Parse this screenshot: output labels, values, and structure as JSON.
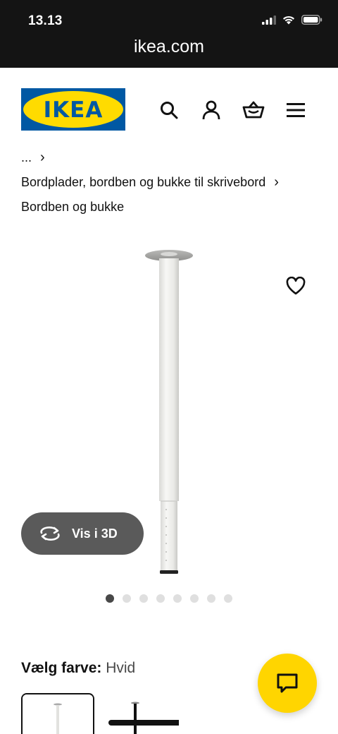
{
  "status_bar": {
    "time": "13.13"
  },
  "browser": {
    "url": "ikea.com"
  },
  "header": {
    "logo_text": "IKEA"
  },
  "breadcrumb": [
    {
      "label": "..."
    },
    {
      "label": "Bordplader, bordben og bukke til skrivebord"
    },
    {
      "label": "Bordben og bukke"
    }
  ],
  "product": {
    "view_3d_label": "Vis i 3D",
    "carousel": {
      "total": 8,
      "active_index": 0
    }
  },
  "color": {
    "label": "Vælg farve:",
    "value": "Hvid",
    "options": [
      "Hvid",
      "Sort"
    ]
  },
  "colors": {
    "ikea_blue": "#0058a3",
    "ikea_yellow": "#ffdb00",
    "chat_yellow": "#ffd500",
    "status_bg": "#141414"
  },
  "icons": [
    "search-icon",
    "account-icon",
    "basket-icon",
    "menu-icon",
    "heart-icon",
    "rotate-3d-icon",
    "chat-icon"
  ]
}
